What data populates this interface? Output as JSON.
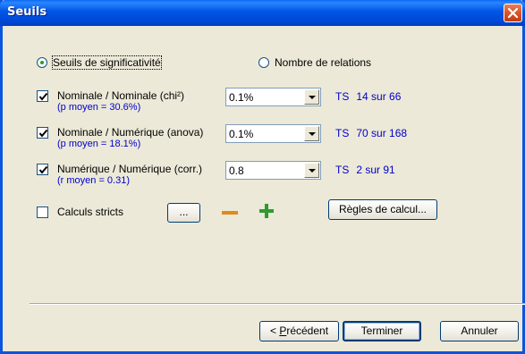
{
  "window": {
    "title": "Seuils",
    "close_icon": "close-icon"
  },
  "mode": {
    "options": [
      {
        "label": "Seuils de significativité",
        "selected": true
      },
      {
        "label": "Nombre de relations",
        "selected": false
      }
    ]
  },
  "rows": [
    {
      "checked": true,
      "label": "Nominale / Nominale (chi²)",
      "sub": "(p moyen = 30.6%)",
      "value": "0.1%",
      "ts": "TS",
      "count": "14 sur 66"
    },
    {
      "checked": true,
      "label": "Nominale / Numérique (anova)",
      "sub": "(p moyen = 18.1%)",
      "value": "0.1%",
      "ts": "TS",
      "count": "70 sur 168"
    },
    {
      "checked": true,
      "label": "Numérique / Numérique (corr.)",
      "sub": "(r moyen = 0.31)",
      "value": "0.8",
      "ts": "TS",
      "count": "2 sur 91"
    }
  ],
  "strict": {
    "label": "Calculs stricts",
    "checked": false
  },
  "buttons": {
    "ellipsis": "...",
    "minus_icon": "minus-icon",
    "plus_icon": "plus-icon",
    "rules": "Règles de calcul...",
    "previous_prefix": "< ",
    "previous_underlined": "P",
    "previous_rest": "récédent",
    "finish": "Terminer",
    "cancel": "Annuler"
  },
  "colors": {
    "title_bar": "#0055e5",
    "link_blue": "#0000cc",
    "minus": "#e08a1e",
    "plus": "#2e9b2e",
    "dialog_bg": "#ece9d8"
  }
}
